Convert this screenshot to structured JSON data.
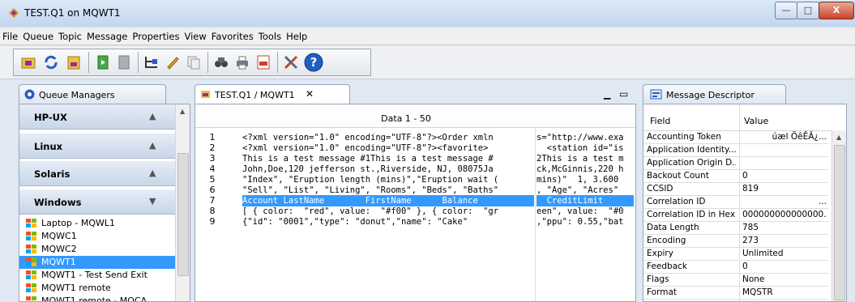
{
  "window": {
    "title": "TEST.Q1 on MQWT1"
  },
  "menu": [
    "File",
    "Queue",
    "Topic",
    "Message",
    "Properties",
    "View",
    "Favorites",
    "Tools",
    "Help"
  ],
  "left_panel": {
    "tab": "Queue Managers",
    "groups": [
      {
        "label": "HP-UX",
        "state": "▲"
      },
      {
        "label": "Linux",
        "state": "▲"
      },
      {
        "label": "Solaris",
        "state": "▲"
      },
      {
        "label": "Windows",
        "state": "▼"
      }
    ],
    "items": [
      "Laptop - MQWL1",
      "MQWC1",
      "MQWC2",
      "MQWT1",
      "MQWT1 - Test Send Exit",
      "MQWT1 remote",
      "MQWT1 remote - MQCA"
    ],
    "selected_index": 3
  },
  "center_panel": {
    "tab": "TEST.Q1 / MQWT1",
    "header": "Data 1 - 50",
    "rows": [
      {
        "n": "1",
        "a": "<?xml version=\"1.0\" encoding=\"UTF-8\"?><Order xmln",
        "b": "s=\"http://www.exa"
      },
      {
        "n": "2",
        "a": "<?xml version=\"1.0\" encoding=\"UTF-8\"?><favorite>",
        "b": "  <station id=\"is"
      },
      {
        "n": "3",
        "a": "This is a test message #1This is a test message #",
        "b": "2This is a test m"
      },
      {
        "n": "4",
        "a": "John,Doe,120 jefferson st.,Riverside, NJ, 08075Ja",
        "b": "ck,McGinnis,220 h"
      },
      {
        "n": "5",
        "a": "\"Index\", \"Eruption length (mins)\",\"Eruption wait (",
        "b": "mins)\"  1, 3.600 "
      },
      {
        "n": "6",
        "a": "\"Sell\", \"List\", \"Living\", \"Rooms\", \"Beds\", \"Baths\"",
        "b": ", \"Age\", \"Acres\""
      },
      {
        "n": "7",
        "a": "Account LastName        FirstName      Balance    ",
        "b": "  CreditLimit    "
      },
      {
        "n": "8",
        "a": "[ { color:  \"red\", value:  \"#f00\" }, { color:  \"gr",
        "b": "een\", value:  \"#0"
      },
      {
        "n": "9",
        "a": "{\"id\": \"0001\",\"type\": \"donut\",\"name\": \"Cake\"",
        "b": ",\"ppu\": 0.55,\"bat"
      }
    ],
    "highlight_index": 6
  },
  "right_panel": {
    "tab": "Message Descriptor",
    "col_field": "Field",
    "col_value": "Value",
    "rows": [
      {
        "f": "Accounting Token",
        "v": "úæl ÕêÊÂ¿..."
      },
      {
        "f": "Application Identity...",
        "v": ""
      },
      {
        "f": "Application Origin D...",
        "v": ""
      },
      {
        "f": "Backout Count",
        "v": "0"
      },
      {
        "f": "CCSID",
        "v": "819"
      },
      {
        "f": "Correlation ID",
        "v": "..."
      },
      {
        "f": "Correlation ID in Hex",
        "v": "000000000000000..."
      },
      {
        "f": "Data Length",
        "v": "785"
      },
      {
        "f": "Encoding",
        "v": "273"
      },
      {
        "f": "Expiry",
        "v": "Unlimited"
      },
      {
        "f": "Feedback",
        "v": "0"
      },
      {
        "f": "Flags",
        "v": "None"
      },
      {
        "f": "Format",
        "v": "MQSTR"
      }
    ]
  },
  "colors": {
    "selection": "#3399ff",
    "close_button": "#c8432b"
  }
}
